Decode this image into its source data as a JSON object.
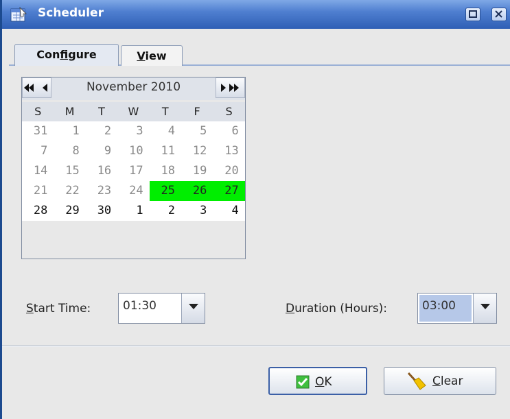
{
  "window": {
    "title": "Scheduler"
  },
  "tabs": [
    {
      "pre": "Con",
      "mn": "f",
      "post": "igure"
    },
    {
      "pre": "",
      "mn": "V",
      "post": "iew"
    }
  ],
  "calendar": {
    "month_label": "November 2010",
    "weekdays": [
      "S",
      "M",
      "T",
      "W",
      "T",
      "F",
      "S"
    ],
    "weeks": [
      [
        "31",
        "1",
        "2",
        "3",
        "4",
        "5",
        "6"
      ],
      [
        "7",
        "8",
        "9",
        "10",
        "11",
        "12",
        "13"
      ],
      [
        "14",
        "15",
        "16",
        "17",
        "18",
        "19",
        "20"
      ],
      [
        "21",
        "22",
        "23",
        "24",
        "25",
        "26",
        "27"
      ],
      [
        "28",
        "29",
        "30",
        "1",
        "2",
        "3",
        "4"
      ]
    ],
    "selected_color": "#00ee00"
  },
  "start_time": {
    "label_mn": "S",
    "label_rest": "tart Time:",
    "value": "01:30"
  },
  "duration": {
    "label_mn": "D",
    "label_rest": "uration (Hours):",
    "value": "03:00"
  },
  "buttons": {
    "ok": {
      "mn": "O",
      "rest": "K"
    },
    "clear": {
      "mn": "C",
      "rest": "lear"
    }
  },
  "icons": {
    "app": "scheduler-app-icon",
    "maximize": "maximize-icon",
    "close": "close-icon",
    "prev_year": "double-left-arrow-icon",
    "prev_month": "left-arrow-icon",
    "next_month": "right-arrow-icon",
    "next_year": "double-right-arrow-icon",
    "ok": "checkmark-icon",
    "clear": "broom-icon"
  }
}
